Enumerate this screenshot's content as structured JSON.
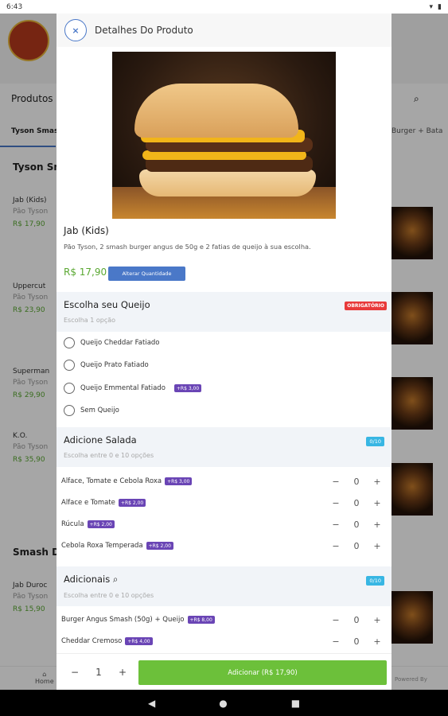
{
  "status": {
    "time": "6:43"
  },
  "background": {
    "produtos_label": "Produtos",
    "tab_active": "Tyson Smash",
    "tab_right": "Burger + Bata",
    "section1": "Tyson Sm",
    "section2": "Smash D",
    "items": [
      {
        "name": "Jab (Kids)",
        "desc": "Pão Tyson",
        "price": "R$ 17,90"
      },
      {
        "name": "Uppercut",
        "desc": "Pão Tyson",
        "price": "R$ 23,90"
      },
      {
        "name": "Superman",
        "desc": "Pão Tyson",
        "price": "R$ 29,90"
      },
      {
        "name": "K.O.",
        "desc": "Pão Tyson",
        "price": "R$ 35,90"
      },
      {
        "name": "Jab Duroc",
        "desc": "Pão Tyson",
        "price": "R$ 15,90"
      }
    ],
    "home_label": "Home",
    "powered_by": "Powered By"
  },
  "modal": {
    "title": "Detalhes Do Produto",
    "product_name": "Jab (Kids)",
    "product_desc": "Pão Tyson, 2 smash burger angus de 50g e 2 fatias de queijo à sua escolha.",
    "price": "R$ 17,90",
    "change_qty_label": "Alterar Quantidade",
    "group1": {
      "title": "Escolha seu Queijo",
      "subtitle": "Escolha 1 opção",
      "badge": "OBRIGATÓRIO",
      "options": [
        {
          "label": "Queijo Cheddar Fatiado",
          "extra": ""
        },
        {
          "label": "Queijo Prato Fatiado",
          "extra": ""
        },
        {
          "label": "Queijo Emmental Fatiado",
          "extra": "+R$ 3,00"
        },
        {
          "label": "Sem Queijo",
          "extra": ""
        }
      ]
    },
    "group2": {
      "title": "Adicione Salada",
      "subtitle": "Escolha entre 0 e 10 opções",
      "badge": "0/10",
      "options": [
        {
          "label": "Alface, Tomate e Cebola Roxa",
          "extra": "+R$ 3,00",
          "qty": "0"
        },
        {
          "label": "Alface e Tomate",
          "extra": "+R$ 2,00",
          "qty": "0"
        },
        {
          "label": "Rúcula",
          "extra": "+R$ 2,00",
          "qty": "0"
        },
        {
          "label": "Cebola Roxa Temperada",
          "extra": "+R$ 2,00",
          "qty": "0"
        }
      ]
    },
    "group3": {
      "title": "Adicionais",
      "subtitle": "Escolha entre 0 e 10 opções",
      "badge": "0/10",
      "options": [
        {
          "label": "Burger Angus Smash (50g) + Queijo",
          "extra": "+R$ 8,00",
          "qty": "0"
        },
        {
          "label": "Cheddar Cremoso",
          "extra": "+R$ 4,00",
          "qty": "0"
        }
      ]
    },
    "footer": {
      "minus": "−",
      "qty": "1",
      "plus": "+",
      "add_label": "Adicionar (R$ 17,90)"
    }
  }
}
